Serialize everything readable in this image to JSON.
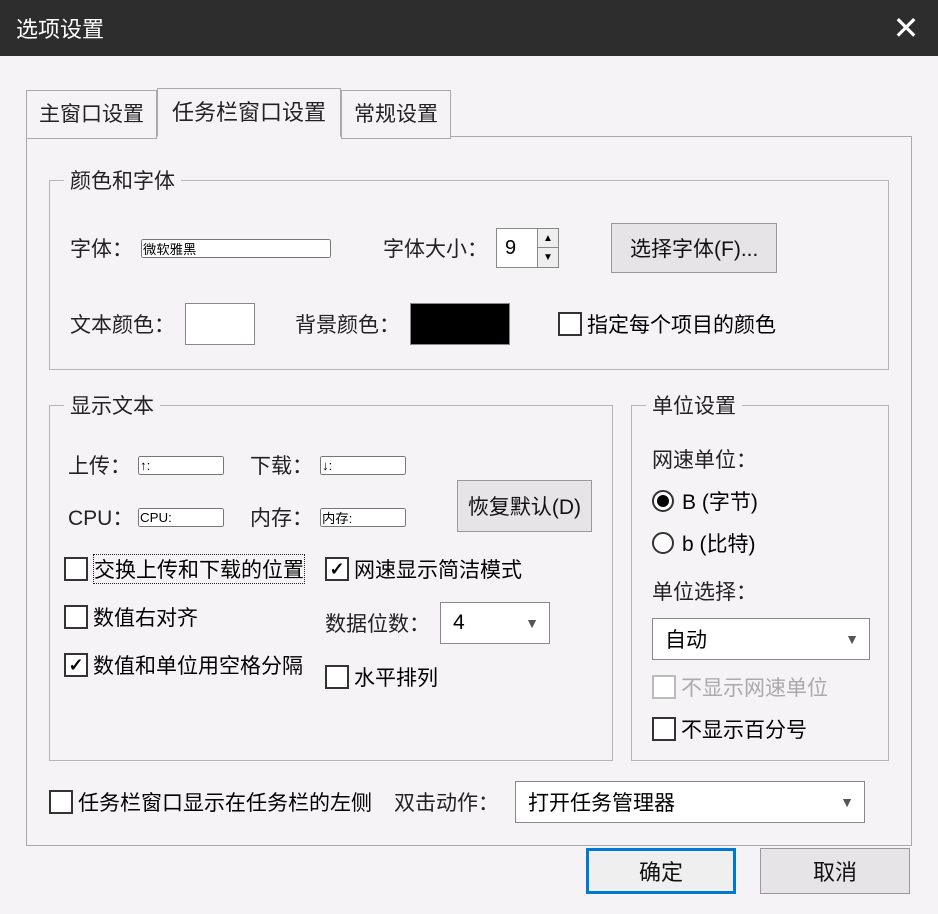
{
  "titlebar": {
    "title": "选项设置",
    "close_icon": "✕"
  },
  "tabs": {
    "main_window": "主窗口设置",
    "taskbar_window": "任务栏窗口设置",
    "general": "常规设置"
  },
  "color_font": {
    "legend": "颜色和字体",
    "font_label": "字体：",
    "font_value": "微软雅黑",
    "font_size_label": "字体大小：",
    "font_size_value": "9",
    "choose_font_btn": "选择字体(F)...",
    "text_color_label": "文本颜色：",
    "text_color_value": "#ffffff",
    "bg_color_label": "背景颜色：",
    "bg_color_value": "#000000",
    "per_item_color_label": "指定每个项目的颜色"
  },
  "display_text": {
    "legend": "显示文本",
    "upload_label": "上传：",
    "upload_value": "↑:",
    "download_label": "下载：",
    "download_value": "↓:",
    "cpu_label": "CPU：",
    "cpu_value": "CPU:",
    "memory_label": "内存：",
    "memory_value": "内存:",
    "restore_default_btn": "恢复默认(D)",
    "swap_upload_download_label": "交换上传和下载的位置",
    "value_right_align_label": "数值右对齐",
    "space_between_value_unit_label": "数值和单位用空格分隔",
    "netspeed_concise_label": "网速显示简洁模式",
    "data_digits_label": "数据位数：",
    "data_digits_value": "4",
    "horizontal_layout_label": "水平排列"
  },
  "unit": {
    "legend": "单位设置",
    "netspeed_unit_label": "网速单位：",
    "byte_label": "B (字节)",
    "bit_label": "b (比特)",
    "unit_select_label": "单位选择：",
    "unit_select_value": "自动",
    "hide_netspeed_unit_label": "不显示网速单位",
    "hide_percent_label": "不显示百分号"
  },
  "bottom": {
    "taskbar_left_label": "任务栏窗口显示在任务栏的左侧",
    "dblclick_label": "双击动作：",
    "dblclick_value": "打开任务管理器"
  },
  "buttons": {
    "ok": "确定",
    "cancel": "取消"
  }
}
